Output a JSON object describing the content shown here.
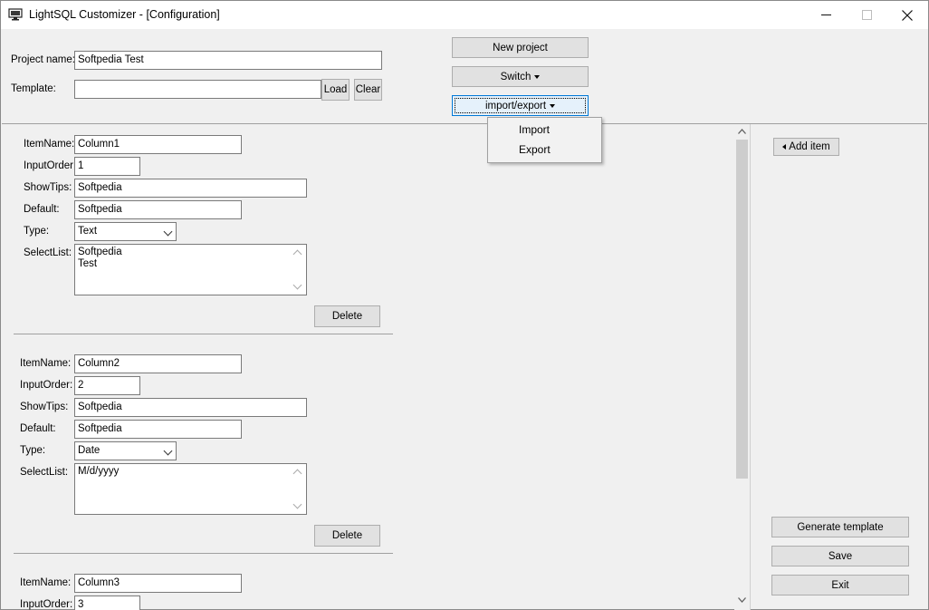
{
  "window": {
    "title": "LightSQL Customizer - [Configuration]"
  },
  "project": {
    "name_label": "Project name:",
    "name_value": "Softpedia Test",
    "template_label": "Template:",
    "template_value": "",
    "load_label": "Load",
    "clear_label": "Clear"
  },
  "toolbar": {
    "new_project": "New project",
    "switch": "Switch",
    "import_export": "import/export"
  },
  "import_export_menu": [
    "Import",
    "Export"
  ],
  "field_labels": {
    "item_name": "ItemName:",
    "input_order": "InputOrder:",
    "show_tips": "ShowTips:",
    "default": "Default:",
    "type": "Type:",
    "select_list": "SelectList:",
    "delete": "Delete"
  },
  "items": [
    {
      "item_name": "Column1",
      "input_order": "1",
      "show_tips": "Softpedia",
      "default": "Softpedia",
      "type": "Text",
      "select_list": [
        "Softpedia",
        "Test"
      ]
    },
    {
      "item_name": "Column2",
      "input_order": "2",
      "show_tips": "Softpedia",
      "default": "Softpedia",
      "type": "Date",
      "select_list": [
        "M/d/yyyy"
      ]
    },
    {
      "item_name": "Column3",
      "input_order": "3"
    }
  ],
  "side": {
    "add_item": "Add item",
    "generate_template": "Generate template",
    "save": "Save",
    "exit": "Exit"
  },
  "icons": {
    "app": "monitor-icon",
    "minimize": "minimize-icon",
    "maximize": "maximize-icon",
    "close": "close-icon"
  },
  "colors": {
    "focus_border": "#0078d7",
    "button_face": "#e1e1e1",
    "window_bg": "#f0f0f0"
  }
}
